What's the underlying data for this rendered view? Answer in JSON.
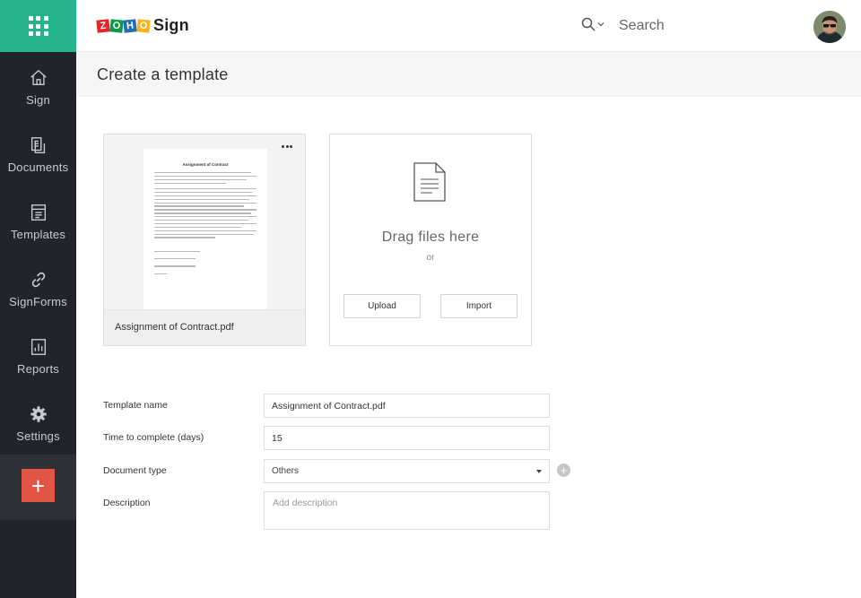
{
  "app": {
    "product_name": "Sign",
    "brand_letters": [
      "Z",
      "O",
      "H",
      "O"
    ]
  },
  "sidebar": {
    "items": [
      {
        "label": "Sign",
        "icon": "home-icon"
      },
      {
        "label": "Documents",
        "icon": "documents-icon"
      },
      {
        "label": "Templates",
        "icon": "templates-icon"
      },
      {
        "label": "SignForms",
        "icon": "link-icon"
      },
      {
        "label": "Reports",
        "icon": "reports-icon"
      },
      {
        "label": "Settings",
        "icon": "gear-icon"
      }
    ],
    "add_label": "+"
  },
  "header": {
    "search_placeholder": "Search"
  },
  "page": {
    "title": "Create a template"
  },
  "document": {
    "file_name": "Assignment of Contract.pdf",
    "preview_title": "Assignment of Contract"
  },
  "dropzone": {
    "drag_text": "Drag files here",
    "or_text": "or",
    "upload_label": "Upload",
    "import_label": "Import"
  },
  "form": {
    "template_name_label": "Template name",
    "template_name_value": "Assignment of Contract.pdf",
    "time_label": "Time to complete (days)",
    "time_value": "15",
    "doc_type_label": "Document type",
    "doc_type_value": "Others",
    "add_type_symbol": "+",
    "description_label": "Description",
    "description_placeholder": "Add description"
  },
  "colors": {
    "sidebar_bg": "#212529",
    "brand_green": "#26b48c",
    "add_red": "#e25545",
    "zoho_red": "#e42527",
    "zoho_green": "#089949",
    "zoho_blue": "#226db4",
    "zoho_yellow": "#f9b21d"
  }
}
